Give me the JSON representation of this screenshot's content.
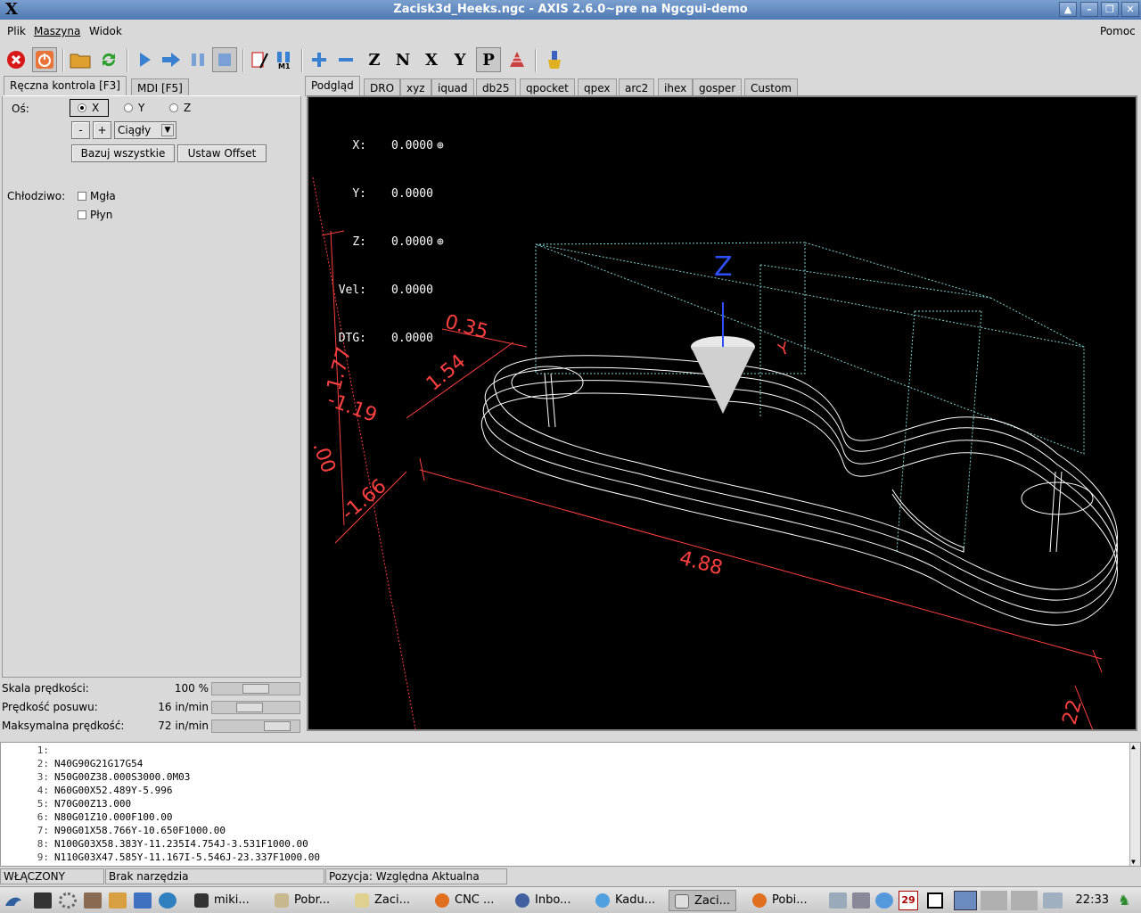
{
  "window": {
    "title": "Zacisk3d_Heeks.ngc - AXIS 2.6.0~pre na Ngcgui-demo",
    "logo": "X"
  },
  "menu": {
    "items": [
      "Plik",
      "Maszyna",
      "Widok"
    ],
    "help": "Pomoc"
  },
  "left_tabs": [
    "Ręczna kontrola [F3]",
    "MDI [F5]"
  ],
  "manual": {
    "axis_label": "Oś:",
    "axes": [
      "X",
      "Y",
      "Z"
    ],
    "selected_axis": "X",
    "minus": "-",
    "plus": "+",
    "jog_mode": "Ciągły",
    "home_all": "Bazuj wszystkie",
    "set_offset": "Ustaw Offset",
    "coolant_label": "Chłodziwo:",
    "mist": "Mgła",
    "flood": "Płyn"
  },
  "overrides": [
    {
      "label": "Skala prędkości:",
      "value": "100 %",
      "level": 0.5
    },
    {
      "label": "Prędkość posuwu:",
      "value": "16 in/min",
      "level": 0.4
    },
    {
      "label": "Maksymalna prędkość:",
      "value": "72 in/min",
      "level": 0.85
    }
  ],
  "right_tabs": [
    "Podgląd",
    "DRO",
    "xyz",
    "iquad",
    "db25",
    "qpocket",
    "qpex",
    "arc2",
    "ihex",
    "gosper",
    "Custom"
  ],
  "dro": [
    {
      "label": "X:",
      "value": "0.0000"
    },
    {
      "label": "Y:",
      "value": "0.0000"
    },
    {
      "label": "Z:",
      "value": "0.0000"
    },
    {
      "label": "Vel:",
      "value": "0.0000"
    },
    {
      "label": "DTG:",
      "value": "0.0000"
    }
  ],
  "dimensions": [
    "1.77",
    "-1.19",
    "0.35",
    "1.54",
    "4.88",
    "22",
    "-1.66",
    ".00"
  ],
  "axis_markers": {
    "z": "Z",
    "y": "Y"
  },
  "gcode": [
    {
      "n": "1:",
      "code": ""
    },
    {
      "n": "2:",
      "code": "N40G90G21G17G54"
    },
    {
      "n": "3:",
      "code": "N50G00Z38.000S3000.0M03"
    },
    {
      "n": "4:",
      "code": "N60G00X52.489Y-5.996"
    },
    {
      "n": "5:",
      "code": "N70G00Z13.000"
    },
    {
      "n": "6:",
      "code": "N80G01Z10.000F100.00"
    },
    {
      "n": "7:",
      "code": "N90G01X58.766Y-10.650F1000.00"
    },
    {
      "n": "8:",
      "code": "N100G03X58.383Y-11.235I4.754J-3.531F1000.00"
    },
    {
      "n": "9:",
      "code": "N110G03X47.585Y-11.167I-5.546J-23.337F1000.00"
    }
  ],
  "status": {
    "state": "WŁĄCZONY",
    "tool": "Brak narzędzia",
    "position": "Pozycja: Względna Aktualna"
  },
  "taskbar": {
    "tasks": [
      "miki...",
      "Pobr...",
      "Zaci...",
      "CNC ...",
      "Inbo...",
      "Kadu...",
      "Zaci...",
      "Pobi..."
    ],
    "date_badge": "29",
    "clock": "22:33"
  },
  "colors": {
    "accent": "#4f79b3",
    "dimension": "#ff4040",
    "toolpath": "#ffffff",
    "extents": "#7fd0d0",
    "z_axis": "#3050ff"
  }
}
